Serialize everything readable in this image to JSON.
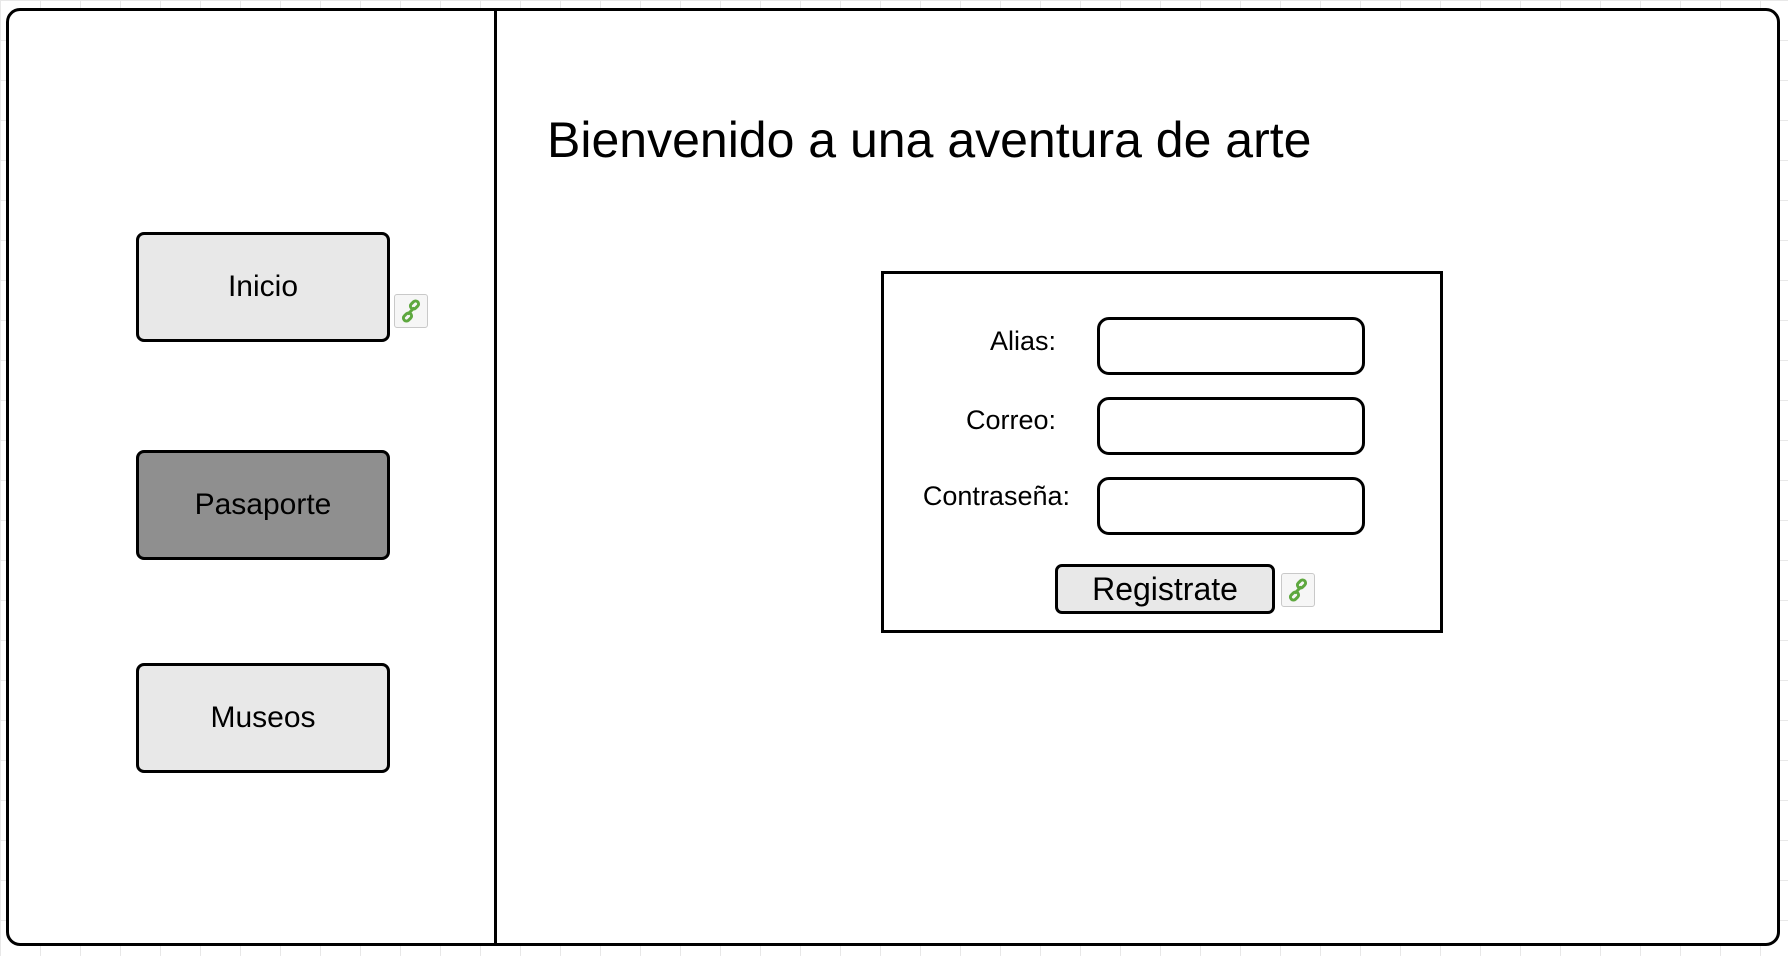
{
  "sidebar": {
    "items": [
      {
        "label": "Inicio",
        "active": false,
        "has_link": true
      },
      {
        "label": "Pasaporte",
        "active": true,
        "has_link": false
      },
      {
        "label": "Museos",
        "active": false,
        "has_link": false
      }
    ]
  },
  "main": {
    "title": "Bienvenido a una aventura de arte"
  },
  "form": {
    "fields": [
      {
        "label": "Alias:",
        "value": ""
      },
      {
        "label": "Correo:",
        "value": ""
      },
      {
        "label": "Contraseña:",
        "value": ""
      }
    ],
    "submit_label": "Registrate"
  },
  "icons": {
    "link_icon": "link-icon"
  },
  "colors": {
    "button_default": "#e8e8e8",
    "button_active": "#8f8f8f",
    "link_icon_green": "#5ea83f"
  }
}
